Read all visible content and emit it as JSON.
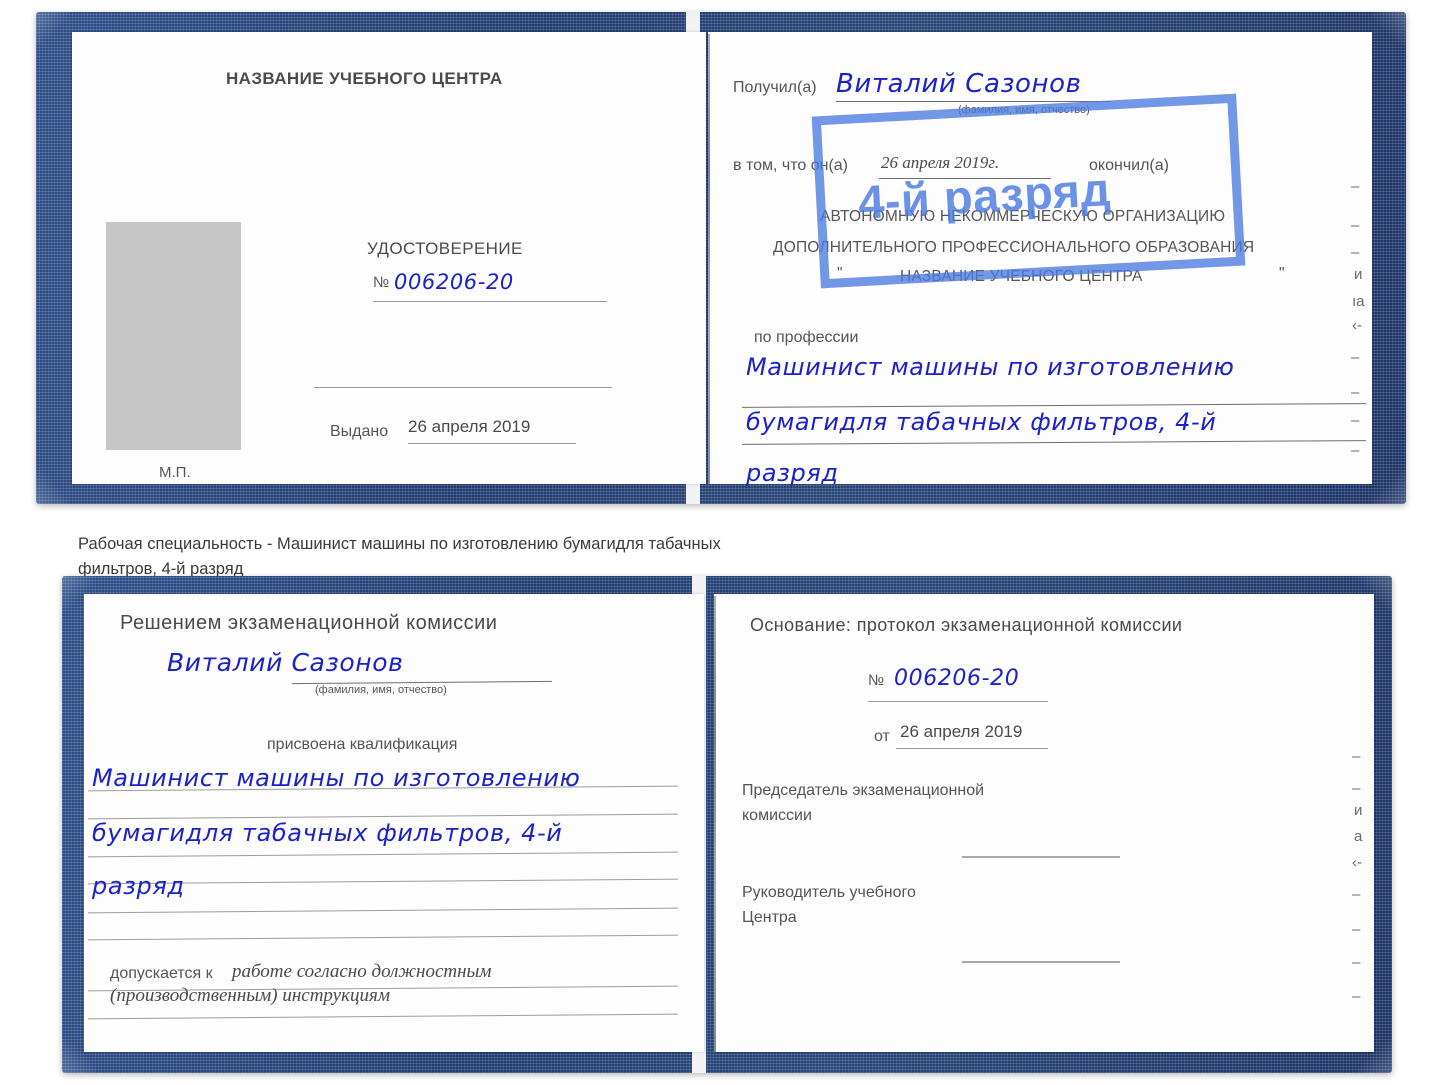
{
  "colors": {
    "cover_blue": "#1f3a6e",
    "ink_blue": "#1a22c8",
    "stamp_blue": "#4a7ae0",
    "page_white": "#fdfdfd",
    "rule_grey": "#9b9b9b",
    "photo_grey": "#c6c6c6"
  },
  "caption": {
    "line1": "Рабочая специальность - Машинист машины по изготовлению бумагидля табачных",
    "line2": "фильтров, 4-й разряд"
  },
  "book_top": {
    "left_page": {
      "org_title": "НАЗВАНИЕ УЧЕБНОГО ЦЕНТРА",
      "doc_title": "УДОСТОВЕРЕНИЕ",
      "number_symbol": "№",
      "number_value": "006206-20",
      "issued_label": "Выдано",
      "issued_value": "26 апреля 2019",
      "stamp_place": "М.П.",
      "photo_placeholder": "photo-placeholder"
    },
    "right_page": {
      "received_label": "Получил(а)",
      "received_value": "Виталий Сазонов",
      "name_hint": "(фамилия, имя, отчество)",
      "in_that_label": "в том, что он(а)",
      "date_value": "26 апреля 2019г.",
      "finished_label": "окончил(а)",
      "org_line1": "АВТОНОМНУЮ НЕКОММЕРЧЕСКУЮ ОРГАНИЗАЦИЮ",
      "org_line2": "ДОПОЛНИТЕЛЬНОГО ПРОФЕССИОНАЛЬНОГО ОБРАЗОВАНИЯ",
      "org_quote_open": "\"",
      "org_line3": "НАЗВАНИЕ УЧЕБНОГО ЦЕНТРА",
      "org_quote_close": "\"",
      "profession_label": "по профессии",
      "profession_line1": "Машинист машины по изготовлению",
      "profession_line2": "бумагидля табачных фильтров, 4-й",
      "profession_line3": "разряд",
      "stamp_text": "4-й разряд"
    },
    "right_margin_fragments": [
      "–",
      "–",
      "–",
      "и",
      "ıа",
      "‹-",
      "–",
      "–",
      "–",
      "–"
    ]
  },
  "book_bottom": {
    "left_page": {
      "decision_title": "Решением экзаменационной комиссии",
      "name_value": "Виталий Сазонов",
      "name_hint": "(фамилия, имя, отчество)",
      "qualification_label": "присвоена квалификация",
      "qual_line1": "Машинист машины по изготовлению",
      "qual_line2": "бумагидля табачных фильтров, 4-й",
      "qual_line3": "разряд",
      "admitted_label": "допускается к",
      "admitted_value_line1": "работе согласно должностным",
      "admitted_value_line2": "(производственным) инструкциям"
    },
    "right_page": {
      "basis_label": "Основание: протокол экзаменационной комиссии",
      "number_symbol": "№",
      "number_value": "006206-20",
      "from_label": "от",
      "from_value": "26 апреля 2019",
      "chairman_line1": "Председатель экзаменационной",
      "chairman_line2": "комиссии",
      "head_line1": "Руководитель учебного",
      "head_line2": "Центра"
    },
    "right_margin_fragments": [
      "–",
      "–",
      "и",
      "а",
      "‹-",
      "–",
      "–",
      "–",
      "–"
    ]
  }
}
